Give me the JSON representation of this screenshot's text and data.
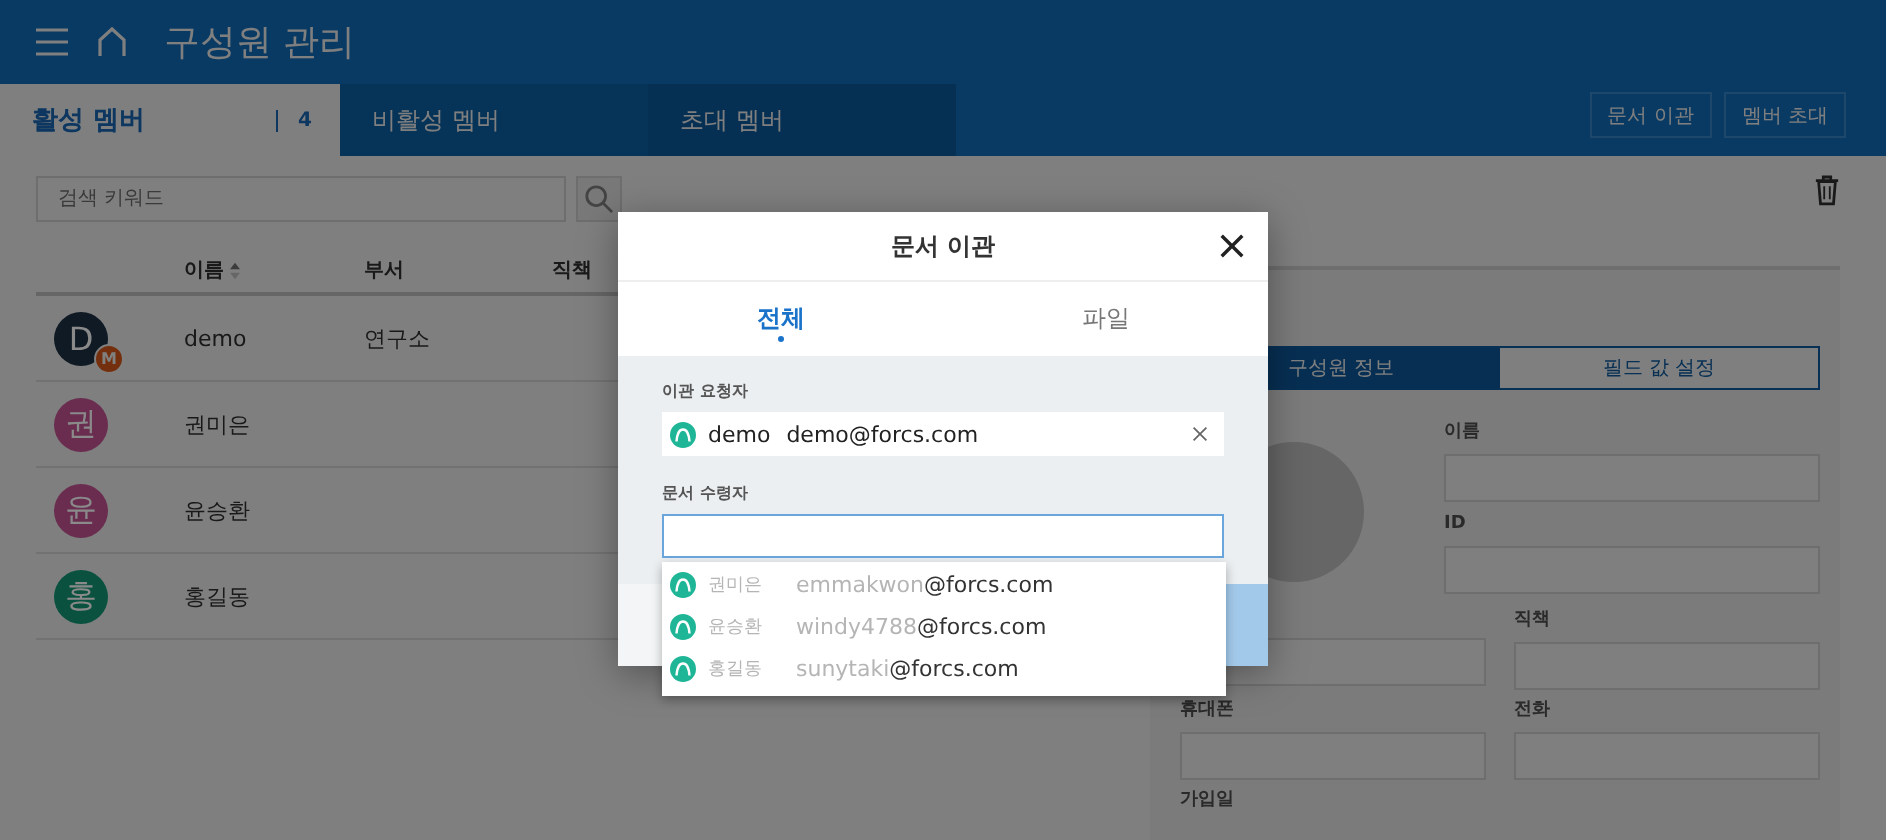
{
  "header": {
    "title": "구성원 관리"
  },
  "tabs": [
    {
      "label": "활성 멤버",
      "count": "4",
      "selected": true
    },
    {
      "label": "비활성 멤버",
      "selected": false
    },
    {
      "label": "초대 멤버",
      "selected": false
    }
  ],
  "header_buttons": [
    "문서 이관",
    "멤버 초대"
  ],
  "search": {
    "placeholder": "검색 키워드"
  },
  "table": {
    "columns": [
      {
        "label": "이름",
        "sorted": true
      },
      {
        "label": "부서",
        "sorted": false
      },
      {
        "label": "직책",
        "sorted": false
      }
    ],
    "rows": [
      {
        "initial": "D",
        "color": "#0f1a24",
        "badge": "M",
        "name": "demo",
        "department": "연구소"
      },
      {
        "initial": "권",
        "color": "#6a2d50",
        "name": "권미은"
      },
      {
        "initial": "윤",
        "color": "#6a2d50",
        "name": "윤승환"
      },
      {
        "initial": "홍",
        "color": "#0a523f",
        "name": "홍길동"
      }
    ]
  },
  "detail": {
    "tabs": [
      {
        "label": "구성원 정보",
        "selected": true
      },
      {
        "label": "필드 값 설정",
        "selected": false
      }
    ],
    "fields": [
      {
        "kind": "wide",
        "label": "이름"
      },
      {
        "kind": "wide",
        "label": "ID"
      },
      {
        "kind": "half"
      },
      {
        "kind": "half",
        "label": "직책"
      },
      {
        "kind": "half",
        "label": "휴대폰"
      },
      {
        "kind": "half",
        "label": "전화"
      },
      {
        "kind": "cut",
        "label": "가입일"
      }
    ]
  },
  "dialog": {
    "title": "문서 이관",
    "tabs": [
      {
        "label": "전체",
        "selected": true
      },
      {
        "label": "파일",
        "selected": false
      }
    ],
    "requester": {
      "label": "이관 요청자",
      "name": "demo",
      "email": "demo@forcs.com"
    },
    "recipient": {
      "label": "문서 수령자",
      "focused": true
    },
    "suggestions": [
      {
        "name": "권미은",
        "local": "emmakwon",
        "domain": "@forcs.com",
        "blurred": true
      },
      {
        "name": "윤승환",
        "local": "windy4788",
        "domain": "@forcs.com",
        "blurred": true
      },
      {
        "name": "홍길동",
        "local": "sunytaki",
        "domain": "@forcs.com",
        "blurred": true
      }
    ]
  }
}
